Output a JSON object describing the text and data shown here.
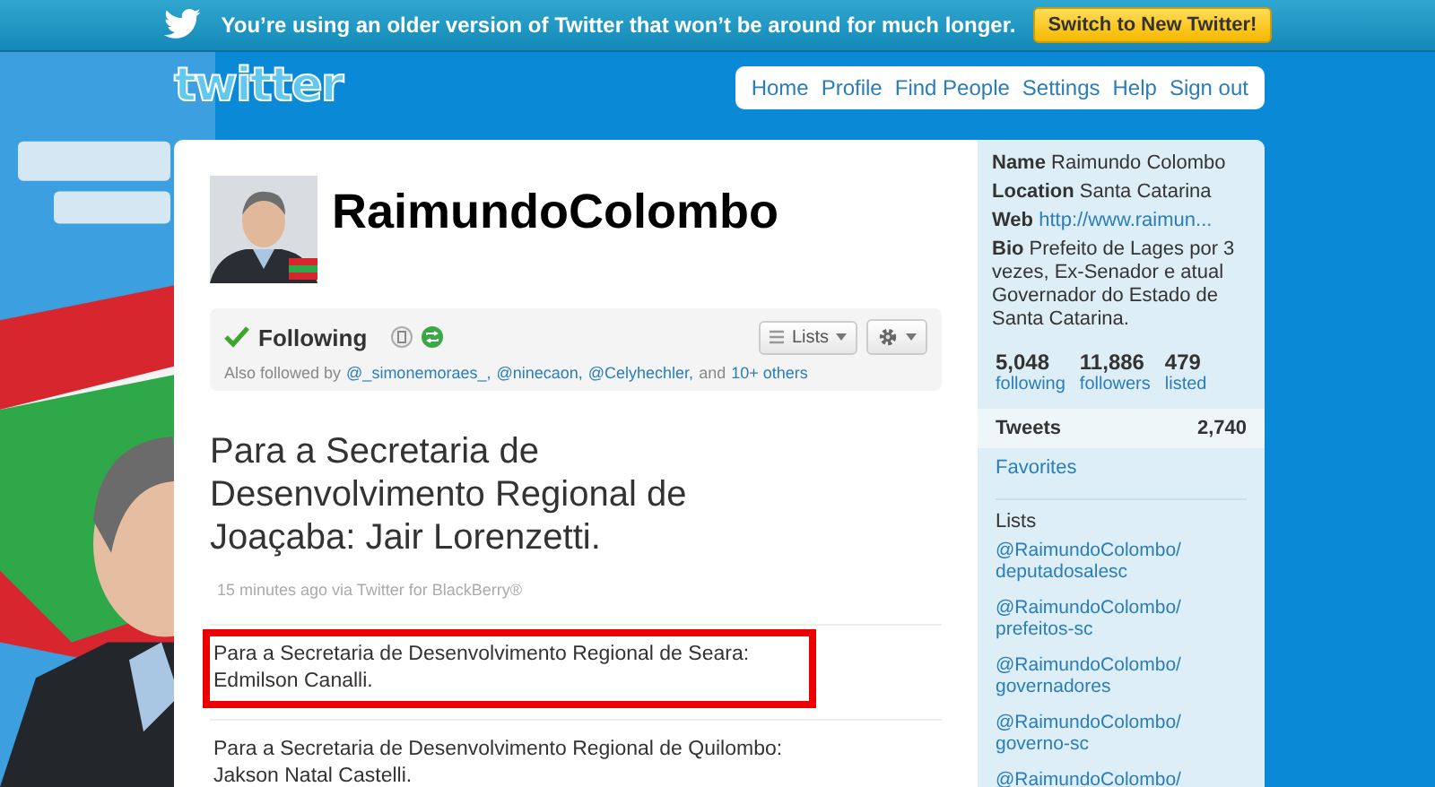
{
  "banner": {
    "text": "You’re using an older version of Twitter that won’t be around for much longer.",
    "button": "Switch to New Twitter!"
  },
  "logo": "twitter",
  "nav": [
    "Home",
    "Profile",
    "Find People",
    "Settings",
    "Help",
    "Sign out"
  ],
  "profile": {
    "name": "RaimundoColombo"
  },
  "follow": {
    "label": "Following",
    "buttons": [
      {
        "kind": "lists",
        "label": "Lists"
      },
      {
        "kind": "gear"
      }
    ],
    "also": [
      {
        "kind": "text",
        "text": "Also followed by"
      },
      {
        "kind": "link",
        "text": "@_simonemoraes_,"
      },
      {
        "kind": "link",
        "text": "@ninecaon,"
      },
      {
        "kind": "link",
        "text": "@Celyhechler,"
      },
      {
        "kind": "text",
        "text": "and"
      },
      {
        "kind": "link",
        "text": "10+ others"
      }
    ]
  },
  "tweets": [
    {
      "kind": "latest",
      "text": "Para a Secretaria de Desenvolvimento Regional de Joaçaba: Jair Lorenzetti.",
      "meta": "15 minutes ago via Twitter for BlackBerry®",
      "highlighted": false
    },
    {
      "kind": "tweet",
      "text": "Para a Secretaria de Desenvolvimento Regional de Seara: Edmilson Canalli.",
      "highlighted": true
    },
    {
      "kind": "tweet",
      "text": "Para a Secretaria de Desenvolvimento Regional de Quilombo: Jakson Natal Castelli.",
      "highlighted": false
    }
  ],
  "sidebar": {
    "bio": [
      {
        "kind": "text",
        "label": "Name",
        "value": "Raimundo Colombo"
      },
      {
        "kind": "text",
        "label": "Location",
        "value": "Santa Catarina"
      },
      {
        "kind": "link",
        "label": "Web",
        "value": "http://www.raimun..."
      },
      {
        "kind": "text",
        "label": "Bio",
        "value": "Prefeito de Lages por 3 vezes, Ex-Senador e atual Governador do Estado de Santa Catarina."
      }
    ],
    "stats": [
      {
        "value": "5,048",
        "label": "following"
      },
      {
        "value": "11,886",
        "label": "followers"
      },
      {
        "value": "479",
        "label": "listed"
      }
    ],
    "menu": [
      {
        "label": "Tweets",
        "count": "2,740",
        "selected": true
      },
      {
        "label": "Favorites",
        "selected": false
      }
    ],
    "lists_title": "Lists",
    "lists": [
      {
        "owner": "@RaimundoColombo/",
        "name": "deputadosalesc"
      },
      {
        "owner": "@RaimundoColombo/",
        "name": "prefeitos-sc"
      },
      {
        "owner": "@RaimundoColombo/",
        "name": "governadores"
      },
      {
        "owner": "@RaimundoColombo/",
        "name": "governo-sc"
      },
      {
        "owner": "@RaimundoColombo/"
      }
    ]
  }
}
